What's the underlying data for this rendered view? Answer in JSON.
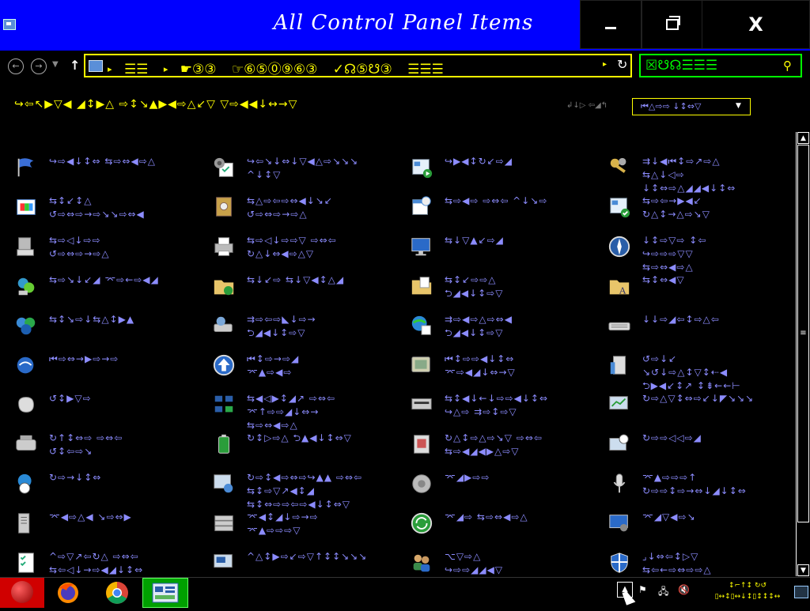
{
  "window": {
    "title": "All Control Panel Items",
    "controls": {
      "minimize": "—",
      "maximize": "❐",
      "close": "X"
    }
  },
  "address": {
    "crumbs": [
      "☰☰",
      "☛③③",
      "☞⑥⑤⓪⑨⑥③",
      "✓☊⑤☋③",
      "☰☰☰"
    ],
    "separator": "▸",
    "dropdown": "▸",
    "refresh": "↻"
  },
  "search": {
    "placeholder": "☒☋☊☰☰☰",
    "icon": "⚲"
  },
  "heading": {
    "text": "↪⇦↖▶▽◀ ◢↕▶△ ⇨↕↘▲▶◀⇨△↙▽ ▽⇨◀◀↓↔→▽",
    "view_by_label": "↲↓▷ ⇦◢↰",
    "view_by_value": "⏮△⇨⇨ ↓↕⇔▽",
    "view_by_arrow": "▼"
  },
  "items": [
    {
      "icon": "flag-icon",
      "label": "↪⇨◀↓↕⇔ ⇆⇨⇔◀⇨△"
    },
    {
      "icon": "settings-checklist-icon",
      "label": "↪⇦↘↓⇔↓▽◀△⇨↘↘↘\n^↓↕▽"
    },
    {
      "icon": "screen-play-icon",
      "label": "↪▶◀↕↻↙⇨◢"
    },
    {
      "icon": "keys-icon",
      "label": "⇉↓◀⏮↕⇨↗⇨△\n⇆△↓◁⇨\n↓↕⇔⇨△◢◢◀↓↕⇔"
    },
    {
      "icon": "colored-window-icon",
      "label": "⇆↕↙↕△\n↺⇨⇔⇨→⇨↘↘⇨⇔◀"
    },
    {
      "icon": "safe-icon",
      "label": "⇆△⇨⇦⇨⇔◀↓↘↙\n↺⇨⇔⇨→⇨△"
    },
    {
      "icon": "calendar-clock-icon",
      "label": "⇆⇨◀⇨ ⇨⇔⇦ ^↓↘⇨"
    },
    {
      "icon": "window-check-icon",
      "label": "⇆⇨⇦→▶◀↙\n↻△↕→△⇨↘▽"
    },
    {
      "icon": "computer-icon",
      "label": "⇆⇨◁↓⇨⇨\n↺⇨⇔⇨→⇨△"
    },
    {
      "icon": "printer-icon",
      "label": "⇆⇨◁↓⇨⇨▽ ⇨⇔⇦\n↻△↓⇔◀⇨△▽"
    },
    {
      "icon": "display-icon",
      "label": "⇆↓▽▲↙⇨◢"
    },
    {
      "icon": "compass-icon",
      "label": "↓↕⇨▽⇨ ↕⇦\n↪⇨⇨⇨▽▽\n⇆⇨⇔◀⇨△"
    },
    {
      "icon": "devices-icon",
      "label": "⇆⇨↘↓↙◢ ⌤⇨←⇨◀◢"
    },
    {
      "icon": "folder-sync-icon",
      "label": "⇆↓↙⇨ ⇆↓▽◀↕△◢"
    },
    {
      "icon": "folder-check-icon",
      "label": "⇆↕↙⇨⇨△\n⮌◢◀↓↕⇨▽"
    },
    {
      "icon": "folder-font-icon",
      "label": "⇆↕⇔◀▽"
    },
    {
      "icon": "homegroup-icon",
      "label": "⇆↕↘⇨↓⇆△↕▶▲"
    },
    {
      "icon": "drive-icon",
      "label": "⇉⇨⇦⇨◣↓⇨→\n⮌◢◀↓↕⇨▽"
    },
    {
      "icon": "globe-check-icon",
      "label": "⇉⇨◀⇨△⇨⇔◀\n⮌◢◀↓↕⇨▽"
    },
    {
      "icon": "keyboard-icon",
      "label": "↓↓⇨◢⇦↕⇨△⇦"
    },
    {
      "icon": "internet-options-icon",
      "label": "⏮⇨⇔→▶⇨→⇨"
    },
    {
      "icon": "upload-icon",
      "label": "⏮↕⇨→⇨◢\n⌤▲⇨◀⇨"
    },
    {
      "icon": "tablet-icon",
      "label": "⏮↕⇨⇨◀↓↕⇔\n⌤⇨◀◢↓⇔→▽"
    },
    {
      "icon": "building-icon",
      "label": "↺⇨↓↙\n↘↺↓⇨△↕▽↕⇠◀\n⮌▶◀↙↕↗ ↕⇟←←⊢"
    },
    {
      "icon": "mouse-icon",
      "label": "↺↕▶▽⇨"
    },
    {
      "icon": "network-icon",
      "label": "⇆◀◁▶↕◢↗ ⇨⇔⇦\n⌤↑⇨⇨◢↓⇔→\n⇆⇨⇔◀⇨△"
    },
    {
      "icon": "keyboard-device-icon",
      "label": "⇆↕◀↓←↓⇨⇨◀↓↕⇔\n↪△⇨ ⇉⇨↕⇨▽"
    },
    {
      "icon": "monitor-chart-icon",
      "label": "↻⇨△▽↕⇔⇨↙↓◤↘↘↘"
    },
    {
      "icon": "phone-modem-icon",
      "label": "↻↑↕⇔⇨ ⇨⇔⇦\n↺↕⇦⇨↘"
    },
    {
      "icon": "battery-icon",
      "label": "↻↕▷⇨△ ⮌▲◀↓↕⇔▽"
    },
    {
      "icon": "programs-icon",
      "label": "↻△↕⇨△⇨↘▽ ⇨⇔⇦\n⇆⇨◀◢◀▶△⇨▽"
    },
    {
      "icon": "region-clock-icon",
      "label": "↻⇨⇨◁◁⇨◢"
    },
    {
      "icon": "globe-clock-icon",
      "label": "↻⇨→↓↕⇔"
    },
    {
      "icon": "remote-window-icon",
      "label": "↻⇨↕◀⇨⇔⇨↪▲▲ ⇨⇔⇦\n⇆↕⇨▽↗◀↕◢\n⇆↕⇔⇨⇨⇦⇨◀↓↕⇔▽"
    },
    {
      "icon": "speaker-icon",
      "label": "⌤◢▶⇨⇨"
    },
    {
      "icon": "microphone-icon",
      "label": "⌤▲⇨⇨⇨↑\n↻⇨⇨↕⇨→⇔↓◢↓↕⇔"
    },
    {
      "icon": "server-icon",
      "label": "⌤◀⇨△◀ ↘⇨⇔▶"
    },
    {
      "icon": "stack-icon",
      "label": "⌤◀↕◢↓⇨→⇨\n⌤▲⇨⇨⇨▽"
    },
    {
      "icon": "sync-icon",
      "label": "⌤◢⇨ ⇆⇨⇔◀⇨△"
    },
    {
      "icon": "monitor-user-icon",
      "label": "⌤◢▽◀⇨↘"
    },
    {
      "icon": "checklist-icon",
      "label": "^⇨▽↗⇦↻△ ⇨⇔⇦\n⇆⇦◁↓→⇨◀◢↓↕⇔"
    },
    {
      "icon": "monitor-icon",
      "label": "^△↕▶⇨↙⇨▽↑↕↕↘↘↘"
    },
    {
      "icon": "users-icon",
      "label": "⌥▽⇨△\n↪⇨⇨◢◢◀▽"
    },
    {
      "icon": "shield-icon",
      "label": "⌟↓⇔⇦↕▷▽\n⇆⇦←⇨⇔⇨⇨△"
    }
  ],
  "taskbar": {
    "apps": [
      "start",
      "firefox",
      "chrome",
      "control-panel"
    ],
    "clock_line1": "↕⌐↑↕ ↻↺",
    "clock_line2": "▯↔↕▯↔↓↕▯↕↕↕↔",
    "tray_chevron": "▲"
  },
  "colors": {
    "title_bar": "#0000ff",
    "background": "#000000",
    "link_text": "#8c8cff",
    "address_border": "#ffff00",
    "search_border": "#00ff00",
    "start_button": "#d00000",
    "active_task": "#00a000"
  }
}
